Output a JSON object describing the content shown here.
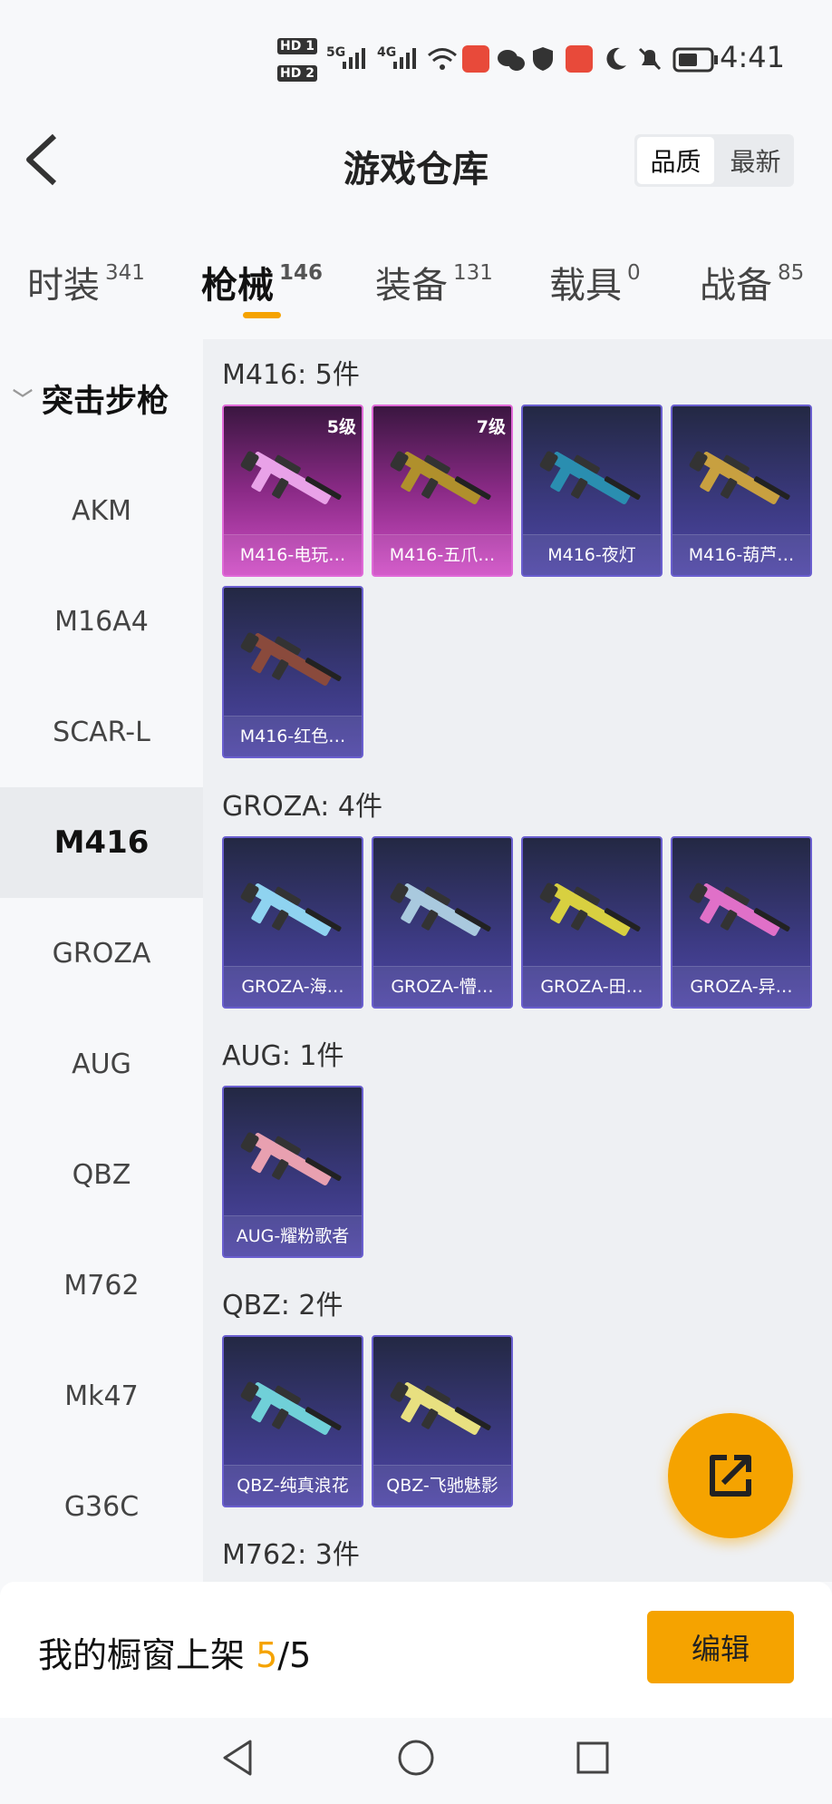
{
  "status": {
    "hd1": "HD 1",
    "hd2": "HD 2",
    "net1": "5G",
    "net2": "4G",
    "time": "4:41"
  },
  "header": {
    "title": "游戏仓库",
    "sort_options": [
      "品质",
      "最新"
    ]
  },
  "tabs": [
    {
      "label": "时装",
      "count": "341"
    },
    {
      "label": "枪械",
      "count": "146"
    },
    {
      "label": "装备",
      "count": "131"
    },
    {
      "label": "载具",
      "count": "0"
    },
    {
      "label": "战备",
      "count": "85"
    }
  ],
  "sidebar": {
    "category": "突击步枪",
    "items": [
      "AKM",
      "M16A4",
      "SCAR-L",
      "M416",
      "GROZA",
      "AUG",
      "QBZ",
      "M762",
      "Mk47",
      "G36C"
    ],
    "active": "M416"
  },
  "groups": [
    {
      "title": "M416: 5件",
      "items": [
        {
          "name": "M416-电玩…",
          "level": "5级",
          "tier": "pink",
          "color": "#e9a2e8"
        },
        {
          "name": "M416-五爪…",
          "level": "7级",
          "tier": "pink",
          "color": "#b0902c"
        },
        {
          "name": "M416-夜灯",
          "tier": "purple",
          "color": "#2a8eb0"
        },
        {
          "name": "M416-葫芦…",
          "tier": "purple",
          "color": "#c8a040"
        },
        {
          "name": "M416-红色…",
          "tier": "purple",
          "color": "#8a4a3c"
        }
      ]
    },
    {
      "title": "GROZA: 4件",
      "items": [
        {
          "name": "GROZA-海…",
          "tier": "purple",
          "color": "#8fd3f0"
        },
        {
          "name": "GROZA-懵…",
          "tier": "purple",
          "color": "#a9c9de"
        },
        {
          "name": "GROZA-田…",
          "tier": "purple",
          "color": "#d8d040"
        },
        {
          "name": "GROZA-异…",
          "tier": "purple",
          "color": "#e070c8"
        }
      ]
    },
    {
      "title": "AUG: 1件",
      "items": [
        {
          "name": "AUG-耀粉歌者",
          "tier": "purple",
          "color": "#e8a0b0"
        }
      ]
    },
    {
      "title": "QBZ: 2件",
      "items": [
        {
          "name": "QBZ-纯真浪花",
          "tier": "purple",
          "color": "#70d0d8"
        },
        {
          "name": "QBZ-飞驰魅影",
          "tier": "purple",
          "color": "#e8e080"
        }
      ]
    },
    {
      "title": "M762: 3件",
      "items": []
    }
  ],
  "bottom": {
    "shelf_prefix": "我的橱窗上架 ",
    "shelf_current": "5",
    "shelf_total": "/5",
    "edit_label": "编辑"
  },
  "colors": {
    "accent": "#f5a300",
    "tier_pink": "#d04fc6",
    "tier_purple": "#4e46a6"
  }
}
